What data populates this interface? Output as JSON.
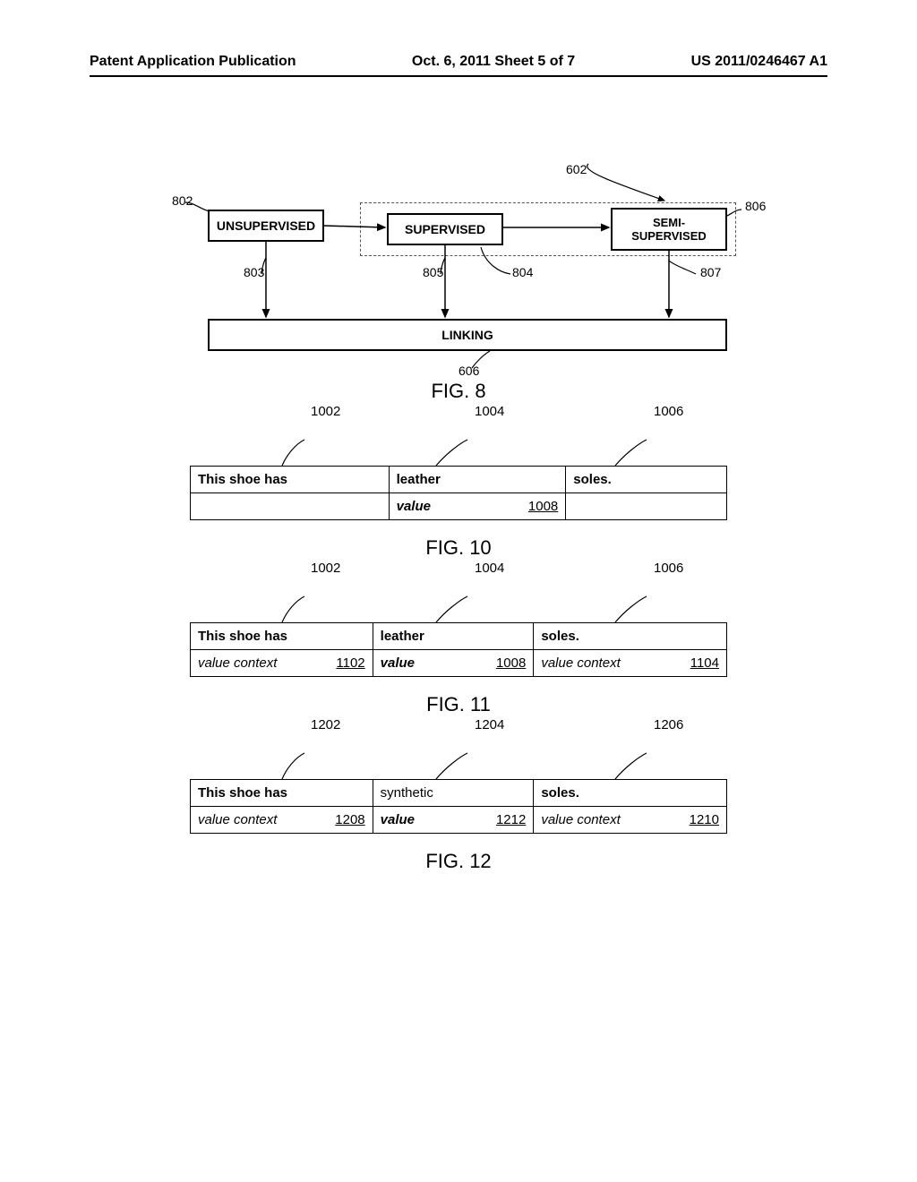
{
  "header": {
    "left": "Patent Application Publication",
    "center": "Oct. 6, 2011  Sheet 5 of 7",
    "right": "US 2011/0246467 A1"
  },
  "fig8": {
    "caption": "FIG. 8",
    "boxes": {
      "unsupervised": "UNSUPERVISED",
      "supervised": "SUPERVISED",
      "semi1": "SEMI-",
      "semi2": "SUPERVISED",
      "linking": "LINKING"
    },
    "refs": {
      "r602": "602",
      "r802": "802",
      "r806": "806",
      "r803": "803",
      "r804": "804",
      "r805": "805",
      "r807": "807",
      "r606": "606"
    }
  },
  "fig10": {
    "caption": "FIG. 10",
    "refs": {
      "r1": "1002",
      "r2": "1004",
      "r3": "1006",
      "r4": "1008"
    },
    "row1": {
      "c1": "This shoe has",
      "c2": "leather",
      "c3": "soles."
    },
    "row2": {
      "c2a": "value"
    }
  },
  "fig11": {
    "caption": "FIG. 11",
    "refs": {
      "r1": "1002",
      "r2": "1004",
      "r3": "1006",
      "ra": "1102",
      "rb": "1008",
      "rc": "1104"
    },
    "row1": {
      "c1": "This shoe has",
      "c2": "leather",
      "c3": "soles."
    },
    "row2": {
      "la": "value context",
      "lb": "value",
      "lc": "value context"
    }
  },
  "fig12": {
    "caption": "FIG. 12",
    "refs": {
      "r1": "1202",
      "r2": "1204",
      "r3": "1206",
      "ra": "1208",
      "rb": "1212",
      "rc": "1210"
    },
    "row1": {
      "c1": "This shoe has",
      "c2": "synthetic",
      "c3": "soles."
    },
    "row2": {
      "la": "value context",
      "lb": "value",
      "lc": "value context"
    }
  }
}
